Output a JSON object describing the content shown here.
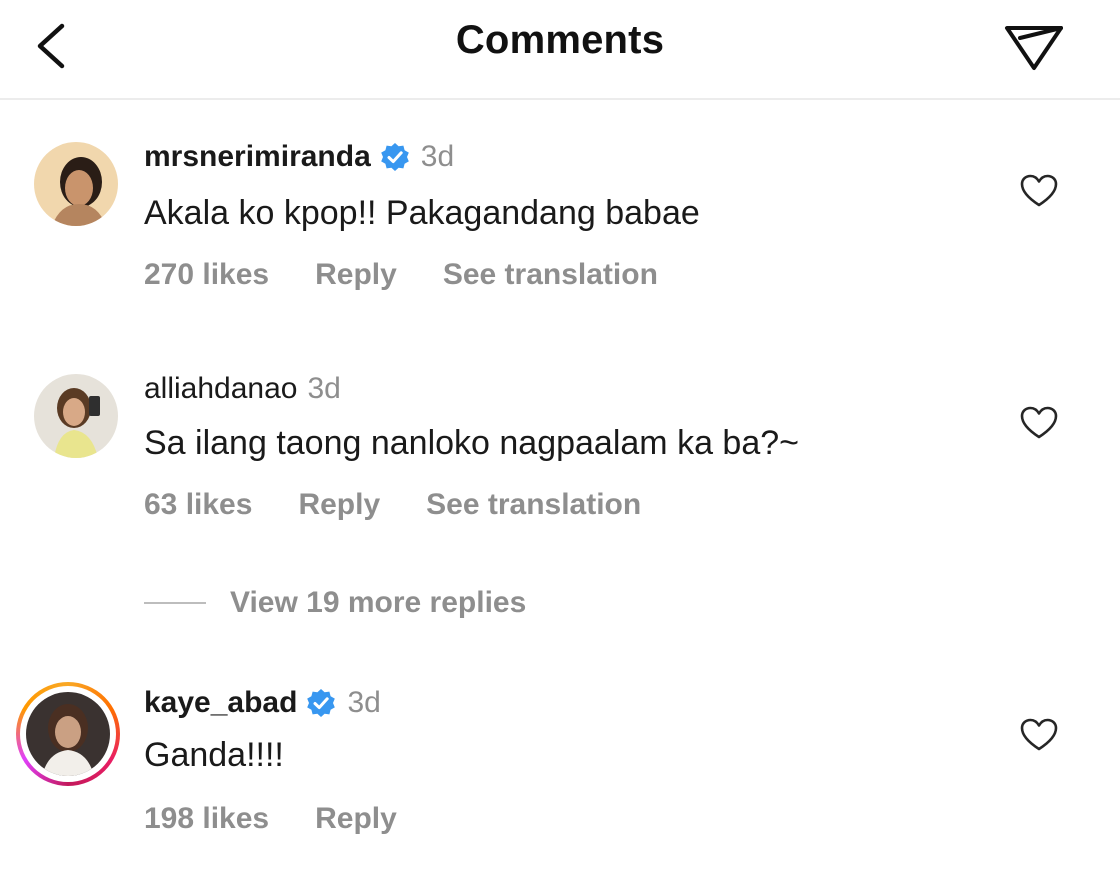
{
  "header": {
    "title": "Comments",
    "back_icon": "chevron-left-icon",
    "send_icon": "paper-plane-icon"
  },
  "comments": [
    {
      "username": "mrsnerimiranda",
      "verified": true,
      "time": "3d",
      "text": "Akala ko kpop!! Pakagandang babae",
      "likes": "270 likes",
      "reply": "Reply",
      "translate": "See translation"
    },
    {
      "username": "alliahdanao",
      "verified": false,
      "time": "3d",
      "text": "Sa ilang taong nanloko nagpaalam ka ba?~",
      "likes": "63 likes",
      "reply": "Reply",
      "translate": "See translation"
    },
    {
      "username": "kaye_abad",
      "verified": true,
      "time": "3d",
      "text": "Ganda!!!!",
      "likes": "198 likes",
      "reply": "Reply"
    }
  ],
  "view_replies": "View 19 more replies",
  "colors": {
    "verified": "#3897f0",
    "muted": "#8e8e8e",
    "text": "#1a1a1a"
  }
}
